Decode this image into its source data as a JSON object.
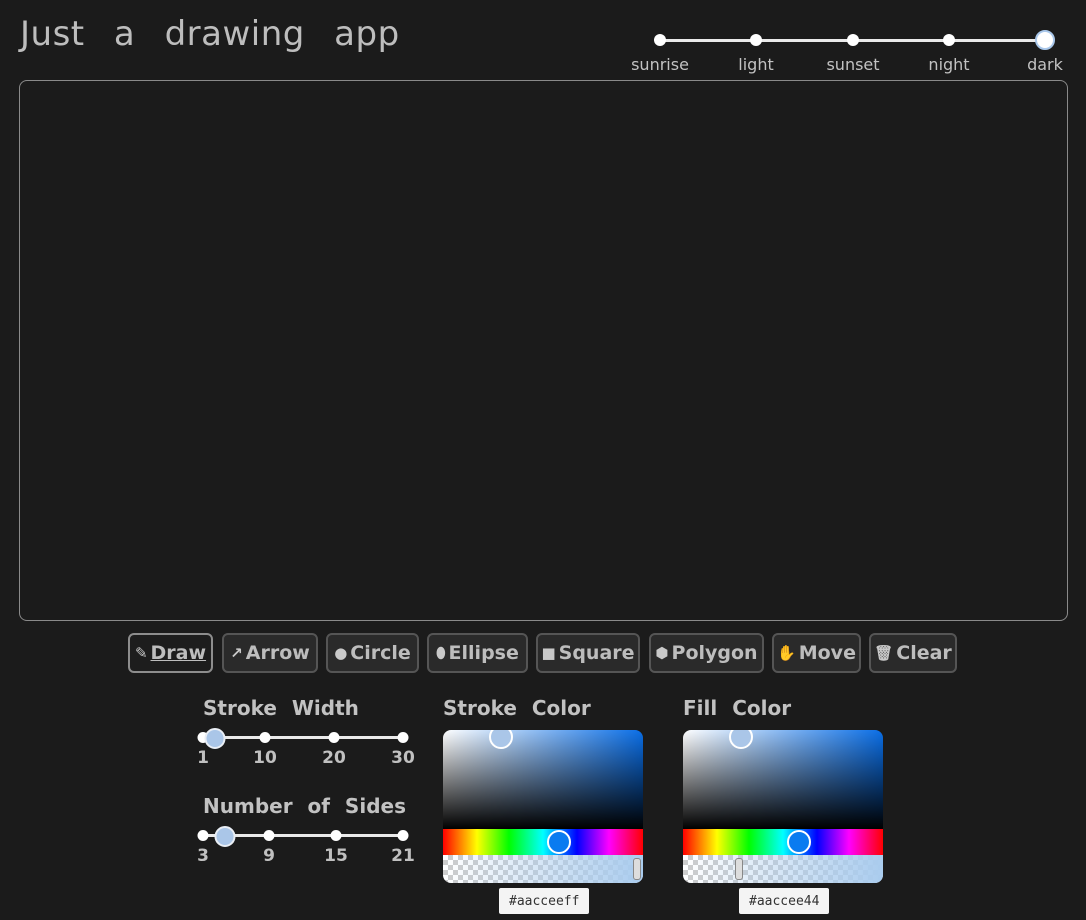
{
  "app": {
    "title": "Just a drawing app"
  },
  "theme": {
    "options": [
      "sunrise",
      "light",
      "sunset",
      "night",
      "dark"
    ],
    "selected": "dark"
  },
  "toolbar": {
    "tools": [
      {
        "label": "Draw",
        "icon": "pencil-icon",
        "active": true
      },
      {
        "label": "Arrow",
        "icon": "arrow-icon",
        "active": false
      },
      {
        "label": "Circle",
        "icon": "circle-icon",
        "active": false
      },
      {
        "label": "Ellipse",
        "icon": "ellipse-icon",
        "active": false
      },
      {
        "label": "Square",
        "icon": "square-icon",
        "active": false
      },
      {
        "label": "Polygon",
        "icon": "polygon-icon",
        "active": false
      },
      {
        "label": "Move",
        "icon": "hand-icon",
        "active": false
      },
      {
        "label": "Clear",
        "icon": "trash-icon",
        "active": false
      }
    ]
  },
  "stroke_width": {
    "title": "Stroke Width",
    "ticks": [
      "1",
      "10",
      "20",
      "30"
    ],
    "value": 4
  },
  "sides": {
    "title": "Number of Sides",
    "ticks": [
      "3",
      "9",
      "15",
      "21"
    ],
    "value": 5
  },
  "stroke_color": {
    "title": "Stroke Color",
    "hex": "#aacceeff",
    "color": "#aacceeff"
  },
  "fill_color": {
    "title": "Fill Color",
    "hex": "#aaccee44",
    "color": "#aaccee44"
  },
  "colors": {
    "background": "#1b1b1b",
    "thumb": "#aac6e8",
    "hue_thumb": "#0a7bf0"
  }
}
